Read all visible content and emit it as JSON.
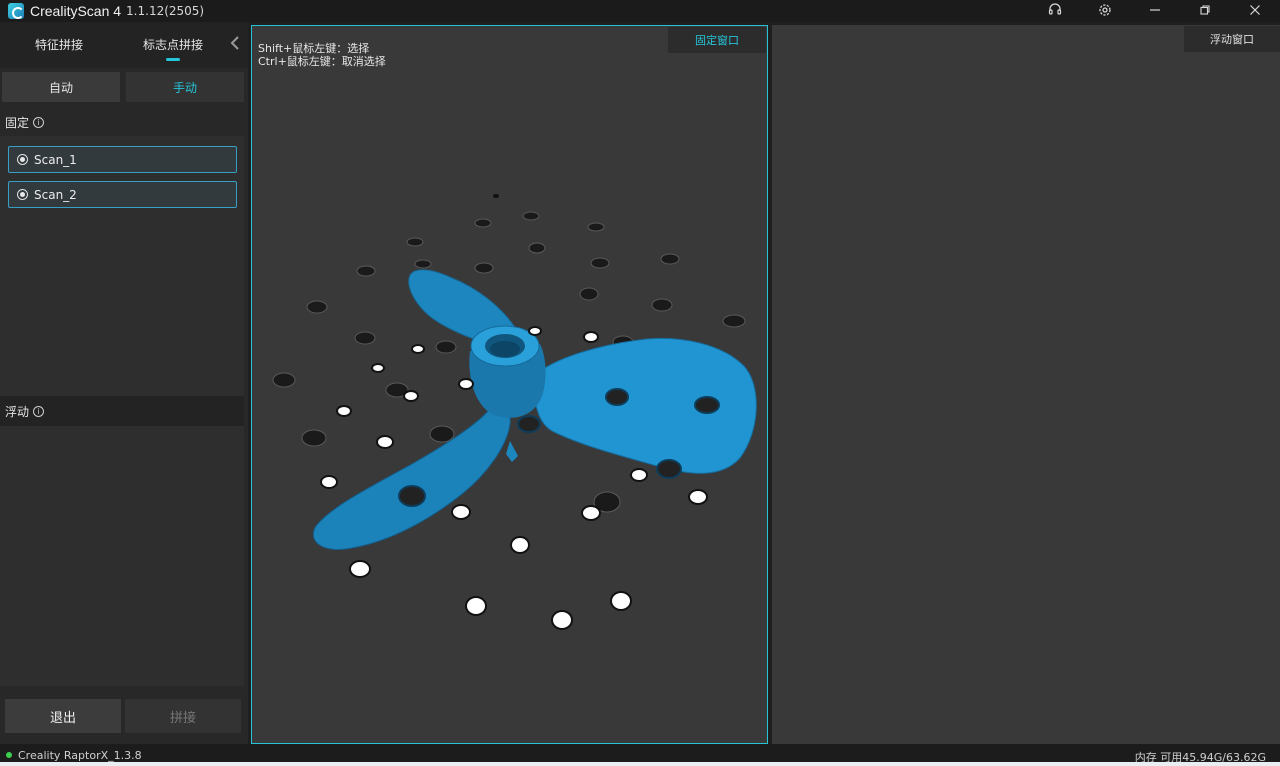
{
  "titlebar": {
    "app_name": "CrealityScan 4",
    "version": "1.1.12(2505)",
    "icons": [
      "headset-icon",
      "settings-icon",
      "minimize-icon",
      "restore-icon",
      "close-icon"
    ]
  },
  "left_panel": {
    "mode_tabs": [
      "特征拼接",
      "标志点拼接"
    ],
    "active_mode_tab": "标志点拼接",
    "sub_tabs": [
      "自动",
      "手动"
    ],
    "active_sub_tab": "手动",
    "fixed_label": "固定",
    "fixed_items": [
      "Scan_1",
      "Scan_2"
    ],
    "float_label": "浮动",
    "float_items": [],
    "exit_button": "退出",
    "stitch_button": "拼接"
  },
  "viewport_fixed": {
    "tag": "固定窗口",
    "hint_line1": "Shift+鼠标左键：选择",
    "hint_line2": "Ctrl+鼠标左键：取消选择"
  },
  "viewport_float": {
    "tag": "浮动窗口"
  },
  "statusbar": {
    "device": "Creality RaptorX_1.3.8",
    "memory": "内存 可用45.94G/63.62G"
  },
  "colors": {
    "accent": "#25c6da",
    "model_blue": "#1e8fc9",
    "status_green": "#3ccf4e"
  }
}
